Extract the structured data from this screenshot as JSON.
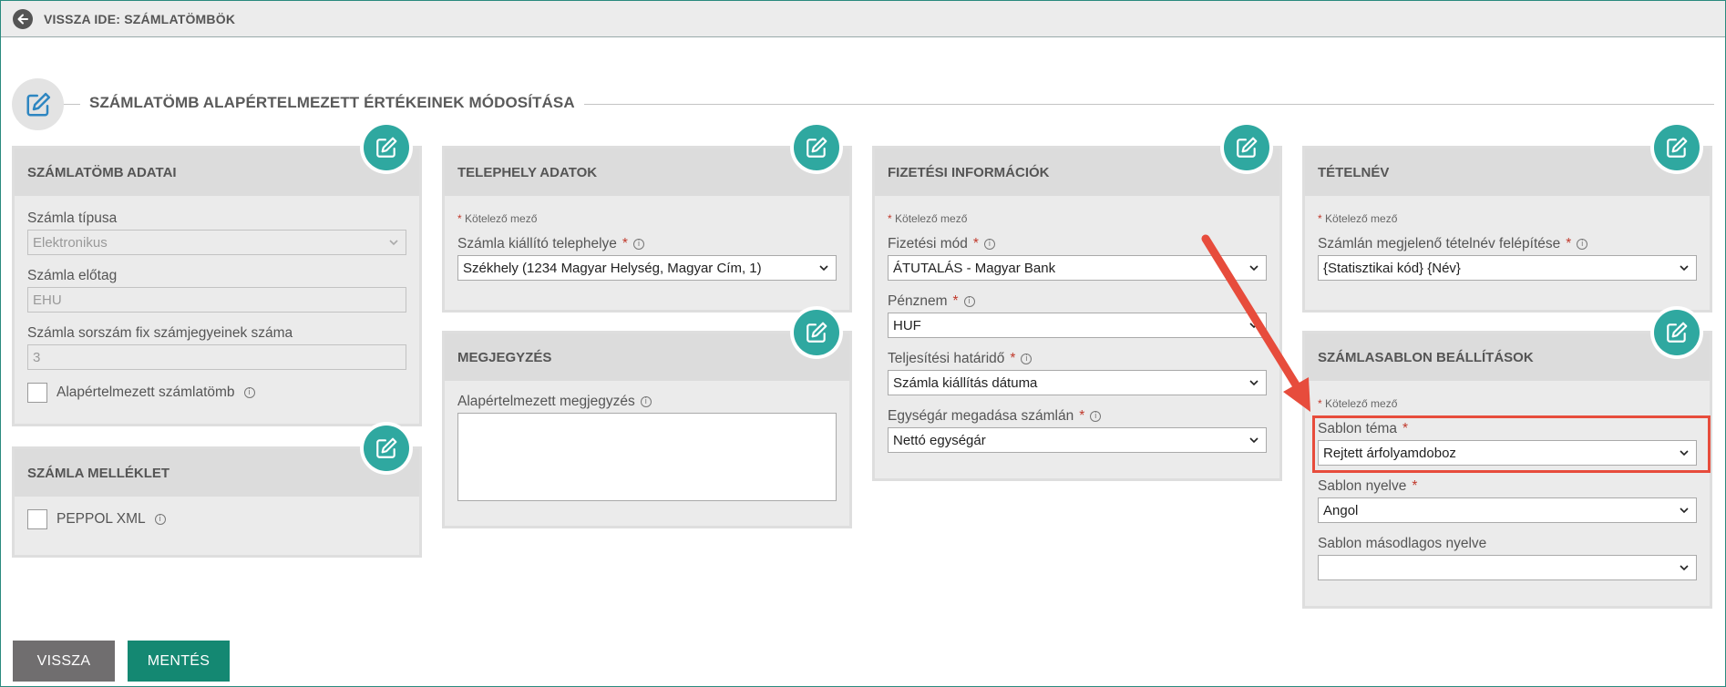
{
  "topbar": {
    "back_label": "VISSZA IDE: SZÁMLATÖMBÖK"
  },
  "page": {
    "title": "SZÁMLATÖMB ALAPÉRTELMEZETT ÉRTÉKEINEK MÓDOSÍTÁSA"
  },
  "common": {
    "required_note": "Kötelező mező",
    "star": "*",
    "info": "i"
  },
  "panels": {
    "szamlatomb": {
      "title": "SZÁMLATÖMB ADATAI",
      "type_label": "Számla típusa",
      "type_value": "Elektronikus",
      "prefix_label": "Számla előtag",
      "prefix_value": "EHU",
      "digits_label": "Számla sorszám fix számjegyeinek száma",
      "digits_value": "3",
      "default_label": "Alapértelmezett számlatömb"
    },
    "melleklet": {
      "title": "SZÁMLA MELLÉKLET",
      "peppol_label": "PEPPOL XML"
    },
    "telephely": {
      "title": "TELEPHELY ADATOK",
      "site_label": "Számla kiállító telephelye",
      "site_value": "Székhely (1234 Magyar Helység, Magyar Cím, 1)"
    },
    "megjegyzes": {
      "title": "MEGJEGYZÉS",
      "note_label": "Alapértelmezett megjegyzés",
      "note_value": ""
    },
    "fizetes": {
      "title": "FIZETÉSI INFORMÁCIÓK",
      "method_label": "Fizetési mód",
      "method_value": "ÁTUTALÁS - Magyar Bank",
      "currency_label": "Pénznem",
      "currency_value": "HUF",
      "deadline_label": "Teljesítési határidő",
      "deadline_value": "Számla kiállítás dátuma",
      "unitprice_label": "Egységár megadása számlán",
      "unitprice_value": "Nettó egységár"
    },
    "tetelnev": {
      "title": "TÉTELNÉV",
      "structure_label": "Számlán megjelenő tételnév felépítése",
      "structure_value": "{Statisztikai kód} {Név}"
    },
    "sablon": {
      "title": "SZÁMLASABLON BEÁLLÍTÁSOK",
      "theme_label": "Sablon téma",
      "theme_value": "Rejtett árfolyamdoboz",
      "lang_label": "Sablon nyelve",
      "lang_value": "Angol",
      "lang2_label": "Sablon másodlagos nyelve",
      "lang2_value": ""
    }
  },
  "buttons": {
    "back": "VISSZA",
    "save": "MENTÉS"
  },
  "colors": {
    "accent": "#2fa8a0",
    "save": "#148872",
    "back": "#706e6f",
    "annotation": "#e74c3c"
  }
}
